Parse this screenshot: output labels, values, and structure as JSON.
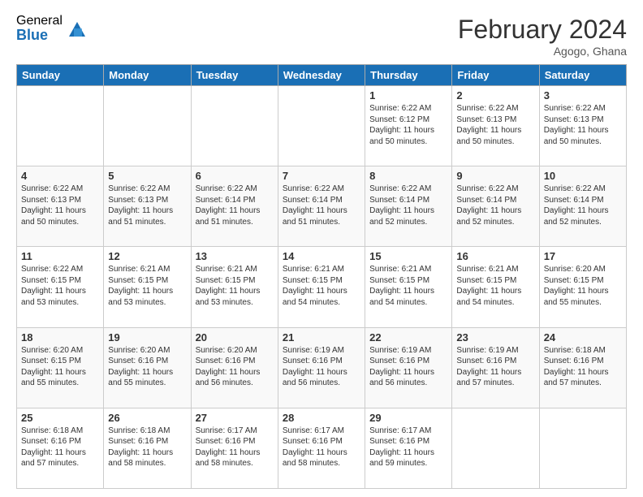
{
  "logo": {
    "general": "General",
    "blue": "Blue"
  },
  "title": {
    "month_year": "February 2024",
    "location": "Agogo, Ghana"
  },
  "days_of_week": [
    "Sunday",
    "Monday",
    "Tuesday",
    "Wednesday",
    "Thursday",
    "Friday",
    "Saturday"
  ],
  "weeks": [
    [
      {
        "num": "",
        "info": ""
      },
      {
        "num": "",
        "info": ""
      },
      {
        "num": "",
        "info": ""
      },
      {
        "num": "",
        "info": ""
      },
      {
        "num": "1",
        "info": "Sunrise: 6:22 AM\nSunset: 6:12 PM\nDaylight: 11 hours\nand 50 minutes."
      },
      {
        "num": "2",
        "info": "Sunrise: 6:22 AM\nSunset: 6:13 PM\nDaylight: 11 hours\nand 50 minutes."
      },
      {
        "num": "3",
        "info": "Sunrise: 6:22 AM\nSunset: 6:13 PM\nDaylight: 11 hours\nand 50 minutes."
      }
    ],
    [
      {
        "num": "4",
        "info": "Sunrise: 6:22 AM\nSunset: 6:13 PM\nDaylight: 11 hours\nand 50 minutes."
      },
      {
        "num": "5",
        "info": "Sunrise: 6:22 AM\nSunset: 6:13 PM\nDaylight: 11 hours\nand 51 minutes."
      },
      {
        "num": "6",
        "info": "Sunrise: 6:22 AM\nSunset: 6:14 PM\nDaylight: 11 hours\nand 51 minutes."
      },
      {
        "num": "7",
        "info": "Sunrise: 6:22 AM\nSunset: 6:14 PM\nDaylight: 11 hours\nand 51 minutes."
      },
      {
        "num": "8",
        "info": "Sunrise: 6:22 AM\nSunset: 6:14 PM\nDaylight: 11 hours\nand 52 minutes."
      },
      {
        "num": "9",
        "info": "Sunrise: 6:22 AM\nSunset: 6:14 PM\nDaylight: 11 hours\nand 52 minutes."
      },
      {
        "num": "10",
        "info": "Sunrise: 6:22 AM\nSunset: 6:14 PM\nDaylight: 11 hours\nand 52 minutes."
      }
    ],
    [
      {
        "num": "11",
        "info": "Sunrise: 6:22 AM\nSunset: 6:15 PM\nDaylight: 11 hours\nand 53 minutes."
      },
      {
        "num": "12",
        "info": "Sunrise: 6:21 AM\nSunset: 6:15 PM\nDaylight: 11 hours\nand 53 minutes."
      },
      {
        "num": "13",
        "info": "Sunrise: 6:21 AM\nSunset: 6:15 PM\nDaylight: 11 hours\nand 53 minutes."
      },
      {
        "num": "14",
        "info": "Sunrise: 6:21 AM\nSunset: 6:15 PM\nDaylight: 11 hours\nand 54 minutes."
      },
      {
        "num": "15",
        "info": "Sunrise: 6:21 AM\nSunset: 6:15 PM\nDaylight: 11 hours\nand 54 minutes."
      },
      {
        "num": "16",
        "info": "Sunrise: 6:21 AM\nSunset: 6:15 PM\nDaylight: 11 hours\nand 54 minutes."
      },
      {
        "num": "17",
        "info": "Sunrise: 6:20 AM\nSunset: 6:15 PM\nDaylight: 11 hours\nand 55 minutes."
      }
    ],
    [
      {
        "num": "18",
        "info": "Sunrise: 6:20 AM\nSunset: 6:15 PM\nDaylight: 11 hours\nand 55 minutes."
      },
      {
        "num": "19",
        "info": "Sunrise: 6:20 AM\nSunset: 6:16 PM\nDaylight: 11 hours\nand 55 minutes."
      },
      {
        "num": "20",
        "info": "Sunrise: 6:20 AM\nSunset: 6:16 PM\nDaylight: 11 hours\nand 56 minutes."
      },
      {
        "num": "21",
        "info": "Sunrise: 6:19 AM\nSunset: 6:16 PM\nDaylight: 11 hours\nand 56 minutes."
      },
      {
        "num": "22",
        "info": "Sunrise: 6:19 AM\nSunset: 6:16 PM\nDaylight: 11 hours\nand 56 minutes."
      },
      {
        "num": "23",
        "info": "Sunrise: 6:19 AM\nSunset: 6:16 PM\nDaylight: 11 hours\nand 57 minutes."
      },
      {
        "num": "24",
        "info": "Sunrise: 6:18 AM\nSunset: 6:16 PM\nDaylight: 11 hours\nand 57 minutes."
      }
    ],
    [
      {
        "num": "25",
        "info": "Sunrise: 6:18 AM\nSunset: 6:16 PM\nDaylight: 11 hours\nand 57 minutes."
      },
      {
        "num": "26",
        "info": "Sunrise: 6:18 AM\nSunset: 6:16 PM\nDaylight: 11 hours\nand 58 minutes."
      },
      {
        "num": "27",
        "info": "Sunrise: 6:17 AM\nSunset: 6:16 PM\nDaylight: 11 hours\nand 58 minutes."
      },
      {
        "num": "28",
        "info": "Sunrise: 6:17 AM\nSunset: 6:16 PM\nDaylight: 11 hours\nand 58 minutes."
      },
      {
        "num": "29",
        "info": "Sunrise: 6:17 AM\nSunset: 6:16 PM\nDaylight: 11 hours\nand 59 minutes."
      },
      {
        "num": "",
        "info": ""
      },
      {
        "num": "",
        "info": ""
      }
    ]
  ]
}
